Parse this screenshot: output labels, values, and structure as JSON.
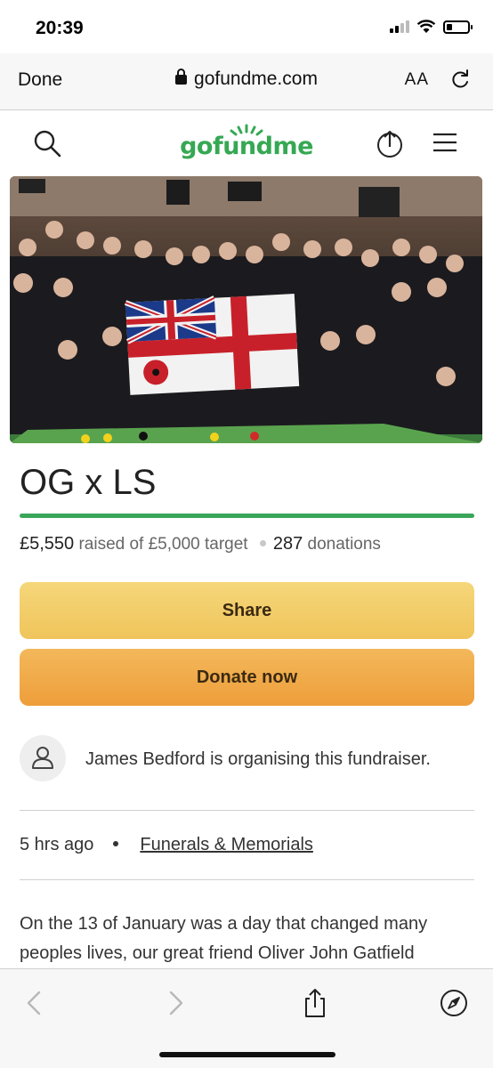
{
  "status_bar": {
    "time": "20:39",
    "icons": [
      "signal-icon",
      "wifi-icon",
      "battery-icon"
    ],
    "battery_level": 0.25
  },
  "browser": {
    "done_label": "Done",
    "url": "gofundme.com",
    "text_size_label": "AA",
    "icons": [
      "lock-icon",
      "reload-icon"
    ]
  },
  "site_header": {
    "logo_text": "gofundme",
    "brand_color": "#35a853",
    "icons": [
      "search-icon",
      "share-icon",
      "menu-icon"
    ]
  },
  "hero_image": {
    "description_icon": "photo"
  },
  "campaign": {
    "title": "OG x LS",
    "raised": "£5,550",
    "raised_suffix": "raised of £5,000 target",
    "donations_count": "287",
    "donations_label": "donations",
    "progress_fraction": 1.0,
    "progress_color": "#3aa65a",
    "share_label": "Share",
    "donate_label": "Donate now",
    "share_button_color": "#f2cd68",
    "donate_button_color": "#f0a847"
  },
  "organiser": {
    "text": "James Bedford is organising this fundraiser."
  },
  "meta": {
    "time_ago": "5 hrs ago",
    "category": "Funerals & Memorials"
  },
  "story": {
    "text": "On the 13 of January was a day that changed many peoples lives, our great friend Oliver John Gatfield"
  },
  "toolbar": {
    "icons": [
      "back-icon",
      "forward-icon",
      "share-icon",
      "compass-icon"
    ]
  }
}
